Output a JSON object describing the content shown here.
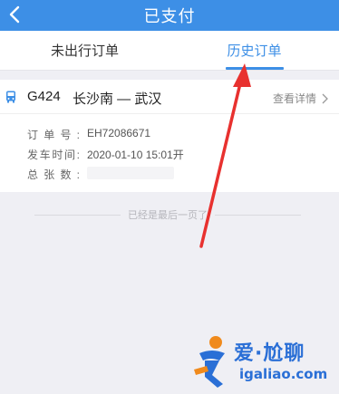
{
  "header": {
    "title": "已支付",
    "back_icon": "chevron-left-icon",
    "color": "#3d8fe6"
  },
  "tabs": [
    {
      "label": "未出行订单",
      "active": false
    },
    {
      "label": "历史订单",
      "active": true
    }
  ],
  "order": {
    "icon": "bus-icon",
    "train_no": "G424",
    "route": "长沙南 — 武汉",
    "detail_label": "查看详情",
    "rows": [
      {
        "label": "订单号:",
        "value": "EH72086671"
      },
      {
        "label": "发车时间:",
        "value": "2020-01-10  15:01开"
      },
      {
        "label": "总张数:",
        "value": ""
      }
    ]
  },
  "end_text": "已经是最后一页了",
  "watermark": {
    "brand": "爱·尬聊",
    "url": "igaliao.com"
  }
}
